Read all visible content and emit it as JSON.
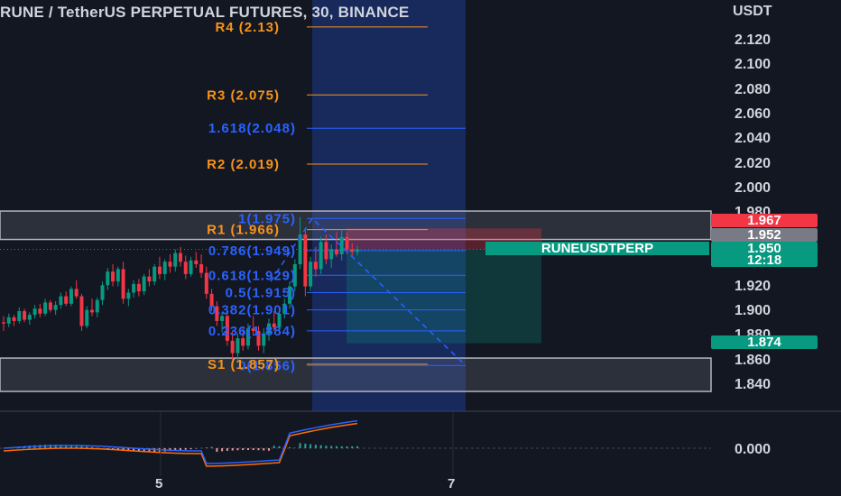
{
  "header": {
    "title": "RUNE / TetherUS PERPETUAL FUTURES, 30, BINANCE",
    "currency": "USDT"
  },
  "price_axis": {
    "ticks": [
      "2.120",
      "2.100",
      "2.080",
      "2.060",
      "2.040",
      "2.020",
      "2.000",
      "1.980",
      "1.920",
      "1.900",
      "1.880",
      "1.860",
      "1.840",
      "0.000"
    ]
  },
  "price_tags": {
    "high": {
      "value": "1.967",
      "color": "#f23645"
    },
    "mid": {
      "value": "1.952",
      "color": "#787b86"
    },
    "last": {
      "value": "1.950",
      "color": "#089981"
    },
    "countdown": {
      "value": "12:18",
      "color": "#089981"
    },
    "low": {
      "value": "1.874",
      "color": "#089981"
    },
    "symbol": "RUNEUSDTPERP"
  },
  "time_axis": {
    "ticks": [
      "5",
      "7"
    ]
  },
  "pivots": [
    {
      "label": "R4 (2.13)",
      "price": 2.13
    },
    {
      "label": "R3 (2.075)",
      "price": 2.075
    },
    {
      "label": "R2 (2.019)",
      "price": 2.019
    },
    {
      "label": "R1 (1.966)",
      "price": 1.966
    },
    {
      "label": "S1 (1.857)",
      "price": 1.857
    }
  ],
  "fibonacci": [
    {
      "label": "1.618(2.048)",
      "price": 2.048
    },
    {
      "label": "1(1.975)",
      "price": 1.975
    },
    {
      "label": "0.786(1.949)",
      "price": 1.949
    },
    {
      "label": "0.618(1.929)",
      "price": 1.929
    },
    {
      "label": "0.5(1.915)",
      "price": 1.915
    },
    {
      "label": "0.382(1.901)",
      "price": 1.901
    },
    {
      "label": "0.236(1.884)",
      "price": 1.884
    },
    {
      "label": "0(1.856)",
      "price": 1.856
    }
  ],
  "colors": {
    "background": "#131722",
    "up": "#089981",
    "down": "#f23645",
    "pivot": "#f7931a",
    "fib": "#2962ff",
    "macd": "#2962ff",
    "signal": "#ff6d00"
  },
  "chart_data": {
    "type": "candlestick",
    "symbol": "RUNEUSDTPERP",
    "interval": "30",
    "exchange": "BINANCE",
    "candles_ohlc": [
      [
        1.891,
        1.896,
        1.884,
        1.89
      ],
      [
        1.89,
        1.898,
        1.887,
        1.895
      ],
      [
        1.895,
        1.897,
        1.888,
        1.892
      ],
      [
        1.892,
        1.903,
        1.89,
        1.9
      ],
      [
        1.9,
        1.902,
        1.891,
        1.893
      ],
      [
        1.893,
        1.899,
        1.889,
        1.897
      ],
      [
        1.897,
        1.905,
        1.894,
        1.902
      ],
      [
        1.902,
        1.906,
        1.895,
        1.898
      ],
      [
        1.898,
        1.91,
        1.896,
        1.907
      ],
      [
        1.907,
        1.909,
        1.899,
        1.901
      ],
      [
        1.901,
        1.908,
        1.897,
        1.905
      ],
      [
        1.905,
        1.915,
        1.902,
        1.912
      ],
      [
        1.912,
        1.916,
        1.904,
        1.906
      ],
      [
        1.906,
        1.92,
        1.904,
        1.918
      ],
      [
        1.918,
        1.925,
        1.91,
        1.912
      ],
      [
        1.912,
        1.914,
        1.884,
        1.888
      ],
      [
        1.888,
        1.904,
        1.886,
        1.901
      ],
      [
        1.901,
        1.91,
        1.896,
        1.899
      ],
      [
        1.899,
        1.911,
        1.895,
        1.909
      ],
      [
        1.909,
        1.924,
        1.905,
        1.921
      ],
      [
        1.921,
        1.935,
        1.917,
        1.932
      ],
      [
        1.932,
        1.938,
        1.92,
        1.924
      ],
      [
        1.924,
        1.936,
        1.92,
        1.934
      ],
      [
        1.934,
        1.94,
        1.906,
        1.91
      ],
      [
        1.91,
        1.918,
        1.904,
        1.915
      ],
      [
        1.915,
        1.925,
        1.911,
        1.922
      ],
      [
        1.922,
        1.926,
        1.912,
        1.916
      ],
      [
        1.916,
        1.93,
        1.913,
        1.928
      ],
      [
        1.928,
        1.934,
        1.92,
        1.924
      ],
      [
        1.924,
        1.938,
        1.921,
        1.936
      ],
      [
        1.936,
        1.944,
        1.926,
        1.93
      ],
      [
        1.93,
        1.942,
        1.925,
        1.94
      ],
      [
        1.94,
        1.946,
        1.931,
        1.936
      ],
      [
        1.936,
        1.95,
        1.932,
        1.947
      ],
      [
        1.947,
        1.952,
        1.936,
        1.94
      ],
      [
        1.94,
        1.945,
        1.926,
        1.93
      ],
      [
        1.93,
        1.944,
        1.928,
        1.941
      ],
      [
        1.941,
        1.948,
        1.935,
        1.938
      ],
      [
        1.938,
        1.946,
        1.927,
        1.931
      ],
      [
        1.931,
        1.936,
        1.91,
        1.914
      ],
      [
        1.914,
        1.918,
        1.9,
        1.904
      ],
      [
        1.904,
        1.908,
        1.888,
        1.892
      ],
      [
        1.892,
        1.899,
        1.883,
        1.896
      ],
      [
        1.896,
        1.9,
        1.872,
        1.876
      ],
      [
        1.876,
        1.884,
        1.86,
        1.866
      ],
      [
        1.866,
        1.882,
        1.858,
        1.878
      ],
      [
        1.878,
        1.886,
        1.868,
        1.872
      ],
      [
        1.872,
        1.89,
        1.869,
        1.886
      ],
      [
        1.886,
        1.896,
        1.88,
        1.884
      ],
      [
        1.884,
        1.888,
        1.868,
        1.872
      ],
      [
        1.872,
        1.886,
        1.866,
        1.882
      ],
      [
        1.882,
        1.894,
        1.876,
        1.89
      ],
      [
        1.89,
        1.9,
        1.884,
        1.887
      ],
      [
        1.887,
        1.902,
        1.884,
        1.898
      ],
      [
        1.898,
        1.91,
        1.894,
        1.906
      ],
      [
        1.906,
        1.924,
        1.902,
        1.92
      ],
      [
        1.92,
        1.942,
        1.916,
        1.938
      ],
      [
        1.938,
        1.976,
        1.934,
        1.962
      ],
      [
        1.962,
        1.966,
        1.912,
        1.92
      ],
      [
        1.92,
        1.944,
        1.916,
        1.94
      ],
      [
        1.94,
        1.952,
        1.928,
        1.934
      ],
      [
        1.934,
        1.96,
        1.93,
        1.956
      ],
      [
        1.956,
        1.962,
        1.938,
        1.942
      ],
      [
        1.942,
        1.954,
        1.935,
        1.95
      ],
      [
        1.95,
        1.964,
        1.944,
        1.946
      ],
      [
        1.946,
        1.966,
        1.941,
        1.96
      ],
      [
        1.96,
        1.964,
        1.946,
        1.95
      ],
      [
        1.95,
        1.955,
        1.944,
        1.948
      ],
      [
        1.948,
        1.953,
        1.945,
        1.95
      ]
    ],
    "support_zone": [
      1.835,
      1.862
    ],
    "resistance_zone": [
      1.958,
      1.981
    ],
    "trade_box": {
      "entry": 1.95,
      "stop": 1.967,
      "target": 1.874
    }
  }
}
